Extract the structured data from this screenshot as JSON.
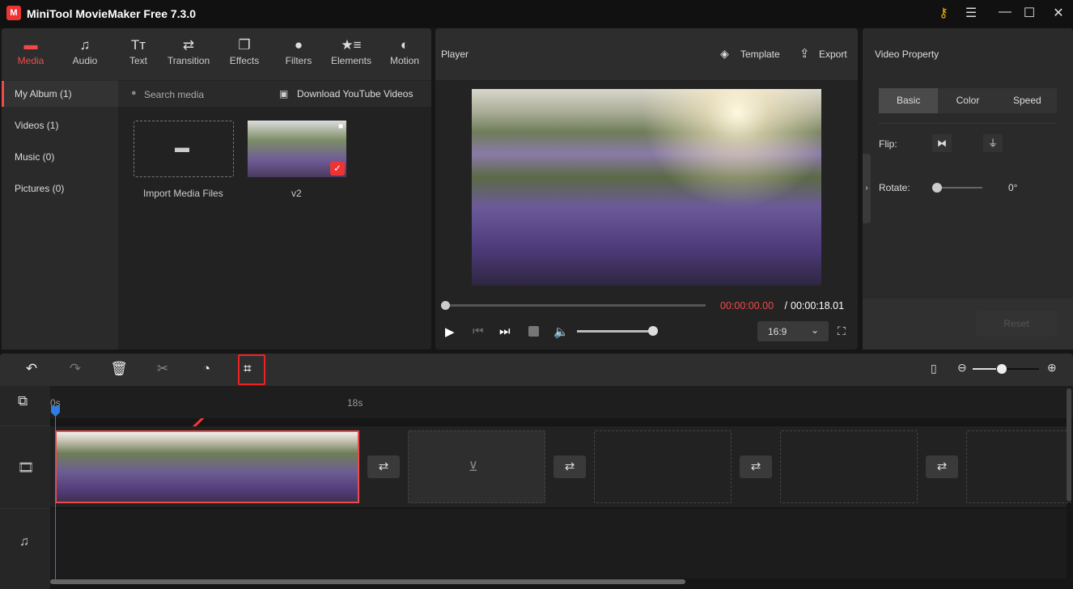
{
  "app": {
    "title": "MiniTool MovieMaker Free 7.3.0",
    "logo_text": "M"
  },
  "window": {
    "key_icon": "key-icon",
    "menu_icon": "menu-icon",
    "minimize_icon": "minimize-icon",
    "maximize_icon": "maximize-icon",
    "close_icon": "close-icon"
  },
  "toolbar": {
    "items": [
      {
        "label": "Media",
        "icon": "folder-icon",
        "active": true
      },
      {
        "label": "Audio",
        "icon": "music-note-icon"
      },
      {
        "label": "Text",
        "icon": "text-icon"
      },
      {
        "label": "Transition",
        "icon": "transition-arrows-icon"
      },
      {
        "label": "Effects",
        "icon": "effects-icon"
      },
      {
        "label": "Filters",
        "icon": "filters-icon"
      },
      {
        "label": "Elements",
        "icon": "elements-icon"
      },
      {
        "label": "Motion",
        "icon": "motion-icon"
      }
    ],
    "glyphs": [
      "▬",
      "♫",
      "Tт",
      "⇄",
      "❐",
      "●",
      "★≡",
      "◐"
    ]
  },
  "sidebar": {
    "items": [
      {
        "label": "My Album (1)",
        "active": true
      },
      {
        "label": "Videos (1)"
      },
      {
        "label": "Music (0)"
      },
      {
        "label": "Pictures (0)"
      }
    ]
  },
  "media": {
    "search_placeholder": "Search media",
    "download_label": "Download YouTube Videos",
    "import_label": "Import Media Files",
    "clip_name": "v2"
  },
  "player": {
    "title": "Player",
    "template_label": "Template",
    "export_label": "Export",
    "current_time": "00:00:00.00",
    "separator": " / ",
    "total_time": "00:00:18.01",
    "aspect_ratio": "16:9",
    "progress": 0,
    "volume": 1.0
  },
  "property": {
    "title": "Video Property",
    "tabs": [
      "Basic",
      "Color",
      "Speed"
    ],
    "active_tab": "Basic",
    "flip_label": "Flip:",
    "rotate_label": "Rotate:",
    "rotate_value": "0°",
    "reset_label": "Reset"
  },
  "timeline": {
    "ruler": [
      "0s",
      "18s"
    ],
    "zoom_level": 0.35
  },
  "colors": {
    "accent": "#ef4a4a",
    "background": "#161616",
    "panel": "#2a2a2a"
  }
}
